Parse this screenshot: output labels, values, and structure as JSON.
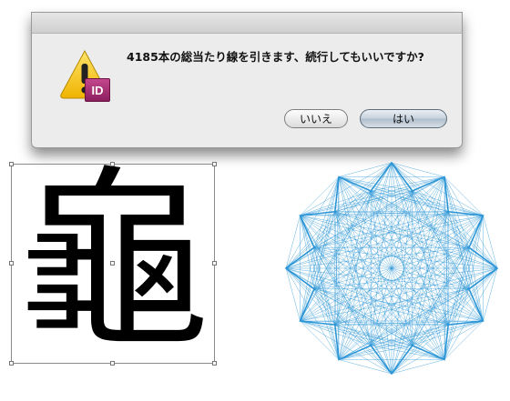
{
  "dialog": {
    "message": "4185本の総当たり線を引きます、続行してもいいですか?",
    "icon_label": "ID",
    "cancel_label": "いいえ",
    "ok_label": "はい"
  },
  "artwork": {
    "kanji": "龜",
    "star_points": 12,
    "accent_color": "#2b95d6"
  }
}
